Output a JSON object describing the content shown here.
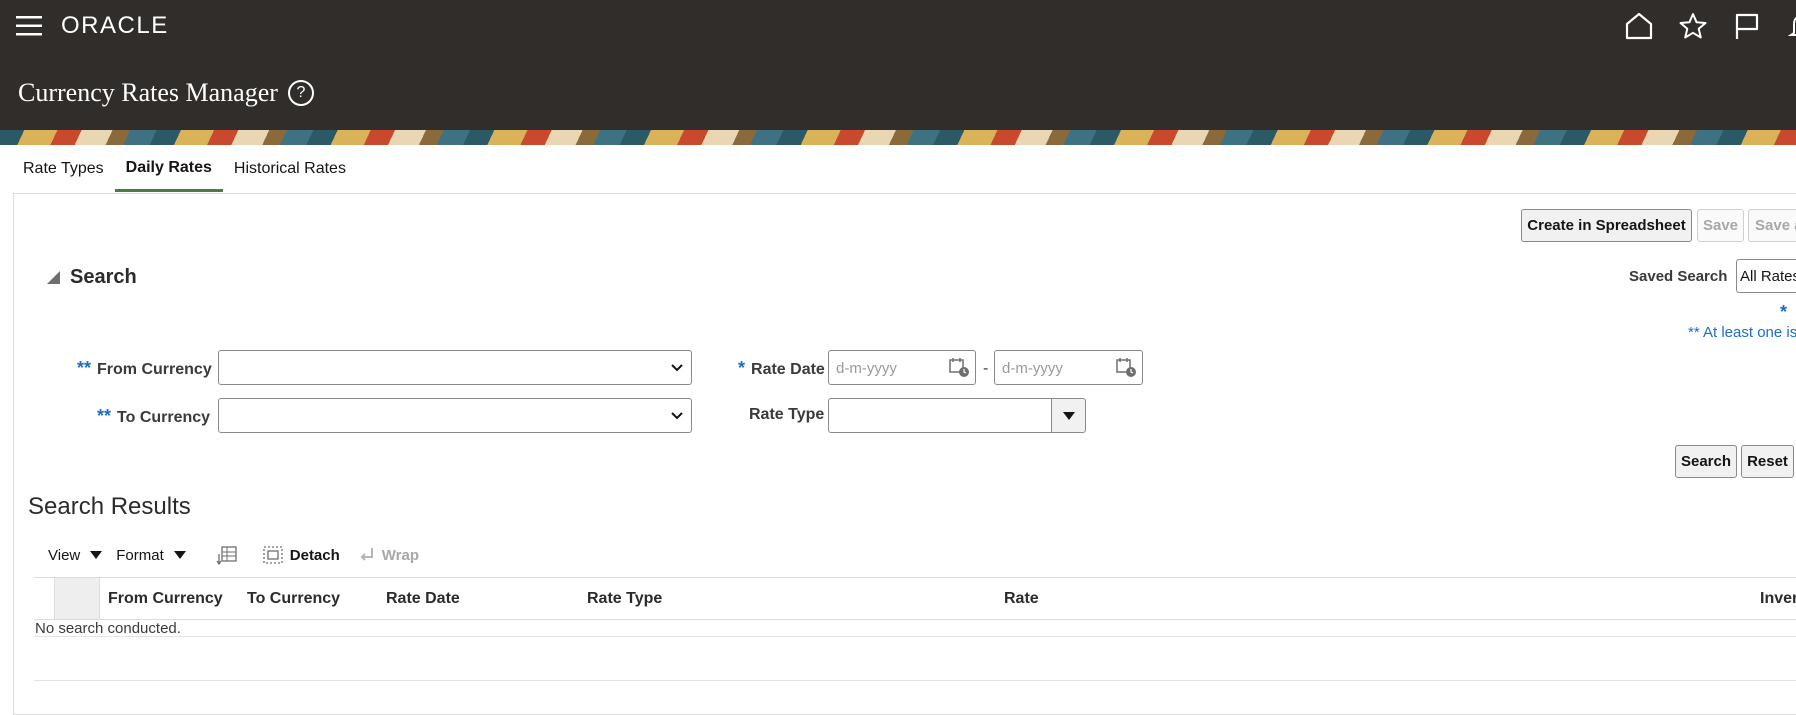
{
  "header": {
    "logo": "ORACLE",
    "page_title": "Currency Rates Manager",
    "help_glyph": "?",
    "icons": [
      "menu-icon",
      "home-icon",
      "star-icon",
      "flag-icon",
      "bell-icon"
    ]
  },
  "tabs": [
    {
      "label": "Rate Types",
      "active": false
    },
    {
      "label": "Daily Rates",
      "active": true
    },
    {
      "label": "Historical Rates",
      "active": false
    }
  ],
  "actions": {
    "create_spreadsheet": "Create in Spreadsheet",
    "save": "Save",
    "save_and": "Save a"
  },
  "search": {
    "title": "Search",
    "saved_search_label": "Saved Search",
    "saved_search_value": "All Rates",
    "required_marker": "*",
    "at_least_one": "** At least one is",
    "from_currency": {
      "required": "**",
      "label": "From Currency",
      "value": ""
    },
    "to_currency": {
      "required": "**",
      "label": "To Currency",
      "value": ""
    },
    "rate_date": {
      "required": "*",
      "label": "Rate Date",
      "from_placeholder": "d-m-yyyy",
      "separator": "-",
      "to_placeholder": "d-m-yyyy"
    },
    "rate_type": {
      "label": "Rate Type",
      "value": ""
    },
    "search_button": "Search",
    "reset_button": "Reset"
  },
  "results": {
    "title": "Search Results",
    "toolbar": {
      "view": "View",
      "format": "Format",
      "detach": "Detach",
      "wrap": "Wrap"
    },
    "columns": [
      "From Currency",
      "To Currency",
      "Rate Date",
      "Rate Type",
      "Rate",
      "Inver"
    ],
    "empty_message": "No search conducted."
  },
  "colors": {
    "header_bg": "#312d2a",
    "active_tab_underline": "#4a7c46",
    "required_blue": "#1b6ec2"
  }
}
